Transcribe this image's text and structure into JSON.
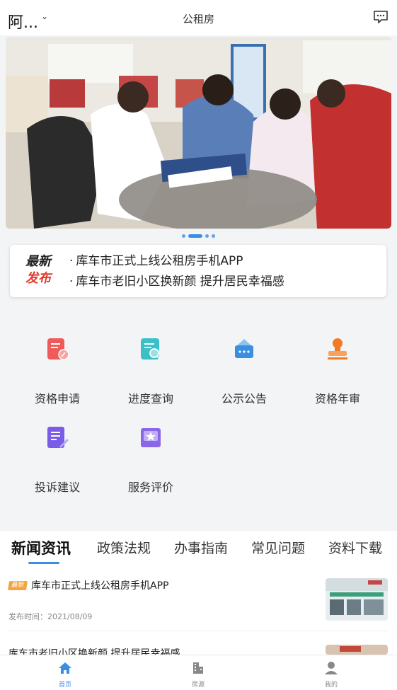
{
  "header": {
    "city": "阿...",
    "title": "公租房"
  },
  "notice": {
    "logo_line1": "最新",
    "logo_line2": "发布",
    "items": [
      "库车市正式上线公租房手机APP",
      "库车市老旧小区换新颜  提升居民幸福感"
    ]
  },
  "services": [
    {
      "label": "资格申请",
      "icon": "application-form-icon",
      "color": "#ef5b5b"
    },
    {
      "label": "进度查询",
      "icon": "progress-search-icon",
      "color": "#3cc0c8"
    },
    {
      "label": "公示公告",
      "icon": "announcement-icon",
      "color": "#3b8fe3"
    },
    {
      "label": "资格年审",
      "icon": "stamp-icon",
      "color": "#f07a26"
    },
    {
      "label": "投诉建议",
      "icon": "complaint-doc-icon",
      "color": "#7b5ce8"
    },
    {
      "label": "服务评价",
      "icon": "rating-star-icon",
      "color": "#8a67e6"
    }
  ],
  "tabs": [
    "新闻资讯",
    "政策法规",
    "办事指南",
    "常见问题",
    "资料下载"
  ],
  "news": [
    {
      "tag": "最新",
      "title": "库车市正式上线公租房手机APP",
      "date": "发布时间：2021/08/09"
    },
    {
      "title": "库车市老旧小区换新颜  提升居民幸福感"
    }
  ],
  "bottom_nav": [
    {
      "label": "首页",
      "icon": "home-icon"
    },
    {
      "label": "房源",
      "icon": "building-icon"
    },
    {
      "label": "我的",
      "icon": "user-icon"
    }
  ],
  "colors": {
    "accent": "#3b8fe3",
    "tag": "#f2a541",
    "highlight": "#e33a2b"
  }
}
